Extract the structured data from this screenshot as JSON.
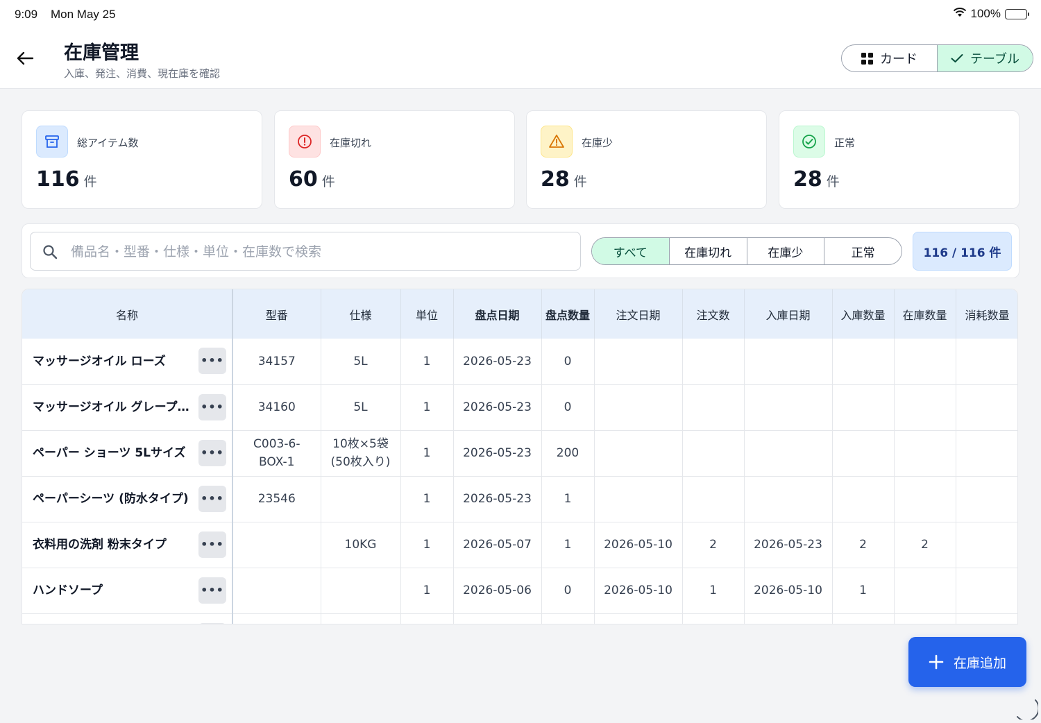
{
  "status_bar": {
    "time": "9:09",
    "date": "Mon May 25",
    "battery": "100%"
  },
  "header": {
    "title": "在庫管理",
    "subtitle": "入庫、発注、消費、現在庫を確認",
    "view_options": {
      "card": "カード",
      "table": "テーブル"
    },
    "active_view": "table"
  },
  "stats": [
    {
      "label": "総アイテム数",
      "value": "116",
      "unit": "件",
      "icon": "box-icon",
      "color": "#3b82f6"
    },
    {
      "label": "在庫切れ",
      "value": "60",
      "unit": "件",
      "icon": "alert-circle-icon",
      "color": "#dc2626"
    },
    {
      "label": "在庫少",
      "value": "28",
      "unit": "件",
      "icon": "warning-triangle-icon",
      "color": "#d97706"
    },
    {
      "label": "正常",
      "value": "28",
      "unit": "件",
      "icon": "check-circle-icon",
      "color": "#16a34a"
    }
  ],
  "filters": {
    "search_placeholder": "備品名・型番・仕様・単位・在庫数で検索",
    "search_value": "",
    "segments": [
      "すべて",
      "在庫切れ",
      "在庫少",
      "正常"
    ],
    "active_segment": "すべて",
    "count_text": "116 / 116 件"
  },
  "table": {
    "headers": [
      "名称",
      "型番",
      "仕様",
      "単位",
      "盘点日期",
      "盘点数量",
      "注文日期",
      "注文数",
      "入庫日期",
      "入庫数量",
      "在庫数量",
      "消耗数量"
    ],
    "rows": [
      [
        "マッサージオイル ローズ",
        "34157",
        "5L",
        "1",
        "2026-05-23",
        "0",
        "",
        "",
        "",
        "",
        "",
        ""
      ],
      [
        "マッサージオイル グレープフルーツ",
        "34160",
        "5L",
        "1",
        "2026-05-23",
        "0",
        "",
        "",
        "",
        "",
        "",
        ""
      ],
      [
        "ペーパー ショーツ 5Lサイズ",
        "C003-6-BOX-1",
        "10枚×5袋 (50枚入り)",
        "1",
        "2026-05-23",
        "200",
        "",
        "",
        "",
        "",
        "",
        ""
      ],
      [
        "ペーパーシーツ (防水タイプ)",
        "23546",
        "",
        "1",
        "2026-05-23",
        "1",
        "",
        "",
        "",
        "",
        "",
        ""
      ],
      [
        "衣料用の洗剤 粉末タイプ",
        "",
        "10KG",
        "1",
        "2026-05-07",
        "1",
        "2026-05-10",
        "2",
        "2026-05-23",
        "2",
        "2",
        ""
      ],
      [
        "ハンドソープ",
        "",
        "",
        "1",
        "2026-05-06",
        "0",
        "2026-05-10",
        "1",
        "2026-05-10",
        "1",
        "",
        ""
      ],
      [
        "",
        "",
        "",
        "",
        "",
        "",
        "",
        "",
        "",
        "",
        "",
        ""
      ]
    ]
  },
  "fab": {
    "label": "在庫追加"
  }
}
